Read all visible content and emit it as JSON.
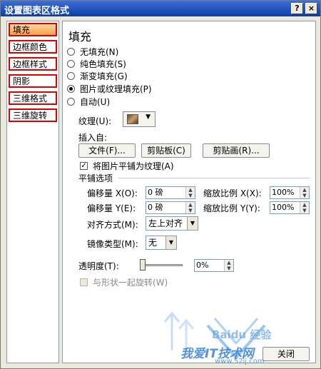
{
  "window": {
    "title": "设置图表区格式",
    "help_label": "?",
    "close_label": "×"
  },
  "nav": {
    "items": [
      {
        "label": "填充",
        "selected": true
      },
      {
        "label": "边框颜色"
      },
      {
        "label": "边框样式"
      },
      {
        "label": "阴影"
      },
      {
        "label": "三维格式"
      },
      {
        "label": "三维旋转"
      }
    ]
  },
  "panel": {
    "title": "填充",
    "fill_options": [
      {
        "label": "无填充(N)"
      },
      {
        "label": "纯色填充(S)"
      },
      {
        "label": "渐变填充(G)"
      },
      {
        "label": "图片或纹理填充(P)",
        "selected": true
      },
      {
        "label": "自动(U)"
      }
    ],
    "texture_label": "纹理(U):",
    "insert_from_label": "插入自:",
    "file_button": "文件(F)...",
    "clipboard_button": "剪贴板(C)",
    "clipart_button": "剪贴画(R)...",
    "tile_checkbox_label": "将图片平铺为纹理(A)",
    "tile_options_heading": "平铺选项",
    "offset_x_label": "偏移量 X(O):",
    "offset_x_value": "0 磅",
    "scale_x_label": "缩放比例 X(X):",
    "scale_x_value": "100%",
    "offset_y_label": "偏移量 Y(E):",
    "offset_y_value": "0 磅",
    "scale_y_label": "缩放比例 Y(Y):",
    "scale_y_value": "100%",
    "align_label": "对齐方式(M):",
    "align_value": "左上对齐",
    "mirror_label": "镜像类型(M):",
    "mirror_value": "无",
    "transparency_label": "透明度(T):",
    "transparency_value": "0%",
    "rotate_label": "与形状一起旋转(W)",
    "close_button": "关闭"
  },
  "watermark": {
    "text": "我爱IT技术网",
    "url": "www.52ij.com",
    "brand": "Baidu 经验"
  },
  "colors": {
    "title_bar": "#0a3ea6",
    "highlight": "#f6a24a",
    "annotation_red": "#e00000"
  }
}
